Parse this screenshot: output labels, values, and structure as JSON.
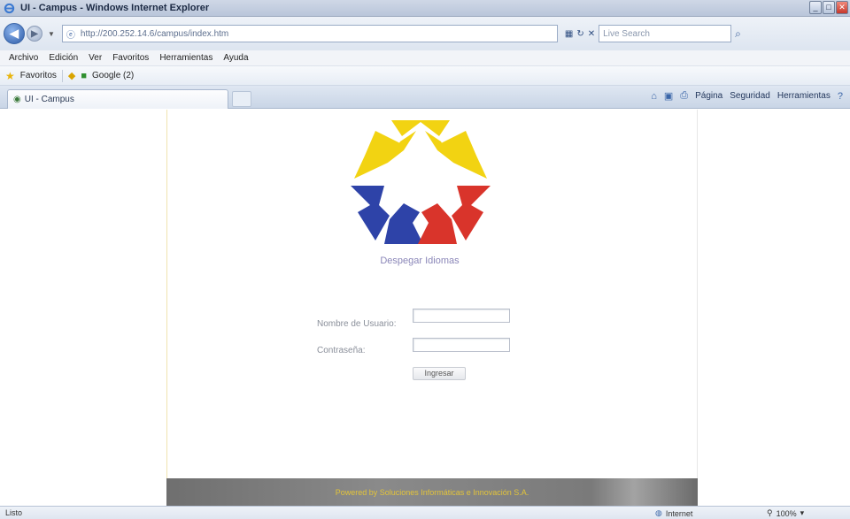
{
  "window": {
    "title": "UI - Campus - Windows Internet Explorer",
    "buttons": [
      "_",
      "□",
      "✕"
    ]
  },
  "address_bar": {
    "url": "http://200.252.14.6/campus/index.htm",
    "search_placeholder": "Live Search"
  },
  "menu": [
    "Archivo",
    "Edición",
    "Ver",
    "Favoritos",
    "Herramientas",
    "Ayuda"
  ],
  "favorites_bar": {
    "favorites_label": "Favoritos",
    "items": [
      "Google (2)"
    ]
  },
  "tab": {
    "label": "UI - Campus"
  },
  "command_bar": [
    "Página",
    "Seguridad",
    "Herramientas"
  ],
  "page": {
    "org_name": "Despegar Idiomas",
    "form": {
      "username_label": "Nombre de Usuario:",
      "username_value": "",
      "password_label": "Contraseña:",
      "password_value": "",
      "submit_label": "Ingresar"
    },
    "footer_text": "Powered by Soluciones Informáticas e Innovación S.A."
  },
  "status_bar": {
    "status_text": "Listo",
    "zone": "Internet",
    "zoom": "100%"
  },
  "colors": {
    "logo_yellow": "#f2d312",
    "logo_blue": "#2e43a8",
    "logo_red": "#d9342b",
    "footer_text": "#e3c43a"
  }
}
